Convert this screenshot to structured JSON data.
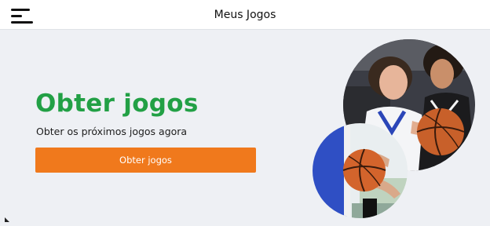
{
  "header": {
    "title": "Meus Jogos",
    "menu_icon": "hamburger-menu-icon"
  },
  "hero": {
    "title": "Obter jogos",
    "subtitle": "Obter os próximos jogos agora",
    "cta_label": "Obter jogos"
  },
  "colors": {
    "accent_green": "#22a045",
    "accent_orange": "#f0791c",
    "background": "#eef0f4"
  }
}
